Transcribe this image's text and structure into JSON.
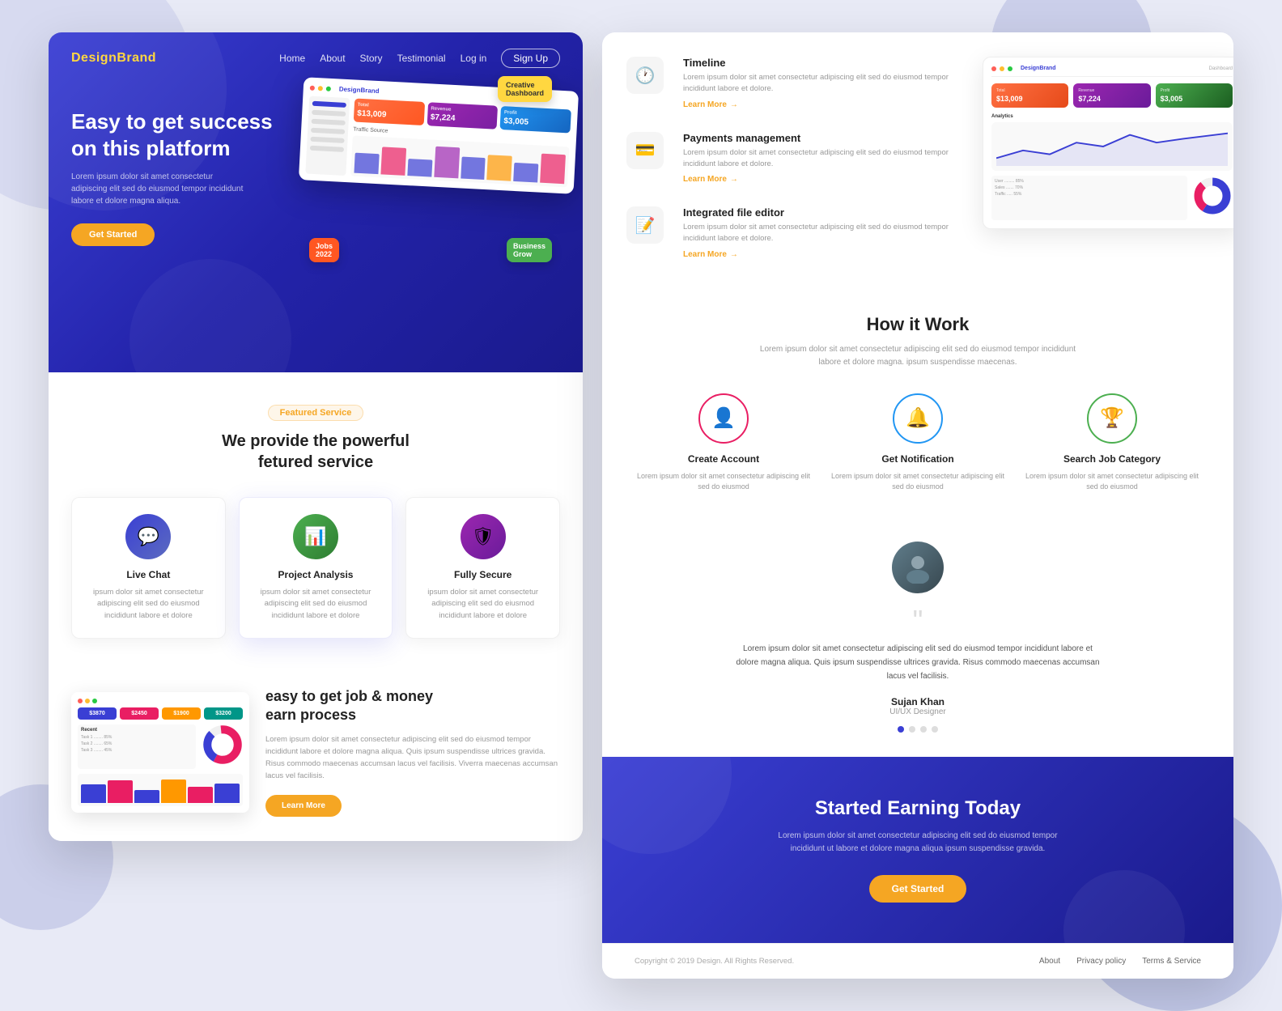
{
  "nav": {
    "logo_prefix": "Design",
    "logo_suffix": "Brand",
    "links": [
      "Home",
      "About",
      "Story",
      "Testimonial"
    ],
    "login": "Log in",
    "signup": "Sign Up"
  },
  "hero": {
    "title_line1": "Easy to get success",
    "title_line2": "on this platform",
    "description": "Lorem ipsum dolor sit amet consectetur adipiscing elit sed do eiusmod tempor incididunt labore et dolore magna aliqua.",
    "cta_button": "Get Started"
  },
  "featured": {
    "tag": "Featured Service",
    "title_line1": "We provide the powerful",
    "title_line2": "fetured service",
    "services": [
      {
        "name": "Live Chat",
        "icon": "💬",
        "description": "ipsum dolor sit amet consectetur adipiscing elit sed do eiusmod incididunt labore et dolore"
      },
      {
        "name": "Project Analysis",
        "icon": "📊",
        "description": "ipsum dolor sit amet consectetur adipiscing elit sed do eiusmod incididunt labore et dolore"
      },
      {
        "name": "Fully Secure",
        "icon": "🛡",
        "description": "ipsum dolor sit amet consectetur adipiscing elit sed do eiusmod incididunt labore et dolore"
      }
    ]
  },
  "earn": {
    "title_line1": "easy to get job & money",
    "title_line2": "earn process",
    "description": "Lorem ipsum dolor sit amet consectetur adipiscing elit sed do eiusmod tempor incididunt labore et dolore magna aliqua. Quis ipsum suspendisse ultrices gravida. Risus commodo maecenas accumsan lacus vel facilisis. Viverra maecenas accumsan lacus vel facilisis.",
    "cta_button": "Learn More"
  },
  "features": [
    {
      "title": "Timeline",
      "icon": "🕐",
      "description": "Lorem ipsum dolor sit amet consectetur adipiscing elit sed do eiusmod tempor incididunt labore et dolore.",
      "learn_more": "Learn More"
    },
    {
      "title": "Payments management",
      "icon": "💳",
      "description": "Lorem ipsum dolor sit amet consectetur adipiscing elit sed do eiusmod tempor incididunt labore et dolore.",
      "learn_more": "Learn More"
    },
    {
      "title": "Integrated file editor",
      "icon": "📝",
      "description": "Lorem ipsum dolor sit amet consectetur adipiscing elit sed do eiusmod tempor incididunt labore et dolore.",
      "learn_more": "Learn More"
    }
  ],
  "how_it_work": {
    "title": "How it Work",
    "description": "Lorem ipsum dolor sit amet consectetur adipiscing elit sed do eiusmod tempor incididunt labore et dolore magna. ipsum suspendisse maecenas.",
    "steps": [
      {
        "name": "Create Account",
        "icon": "👤",
        "description": "Lorem ipsum dolor sit amet consectetur adipiscing elit sed do eiusmod"
      },
      {
        "name": "Get Notification",
        "icon": "🔔",
        "description": "Lorem ipsum dolor sit amet consectetur adipiscing elit sed do eiusmod"
      },
      {
        "name": "Search Job Category",
        "icon": "🏆",
        "description": "Lorem ipsum dolor sit amet consectetur adipiscing elit sed do eiusmod"
      }
    ]
  },
  "testimonial": {
    "quote": "Lorem ipsum dolor sit amet consectetur adipiscing elit sed do eiusmod tempor incididunt labore et dolore magna aliqua. Quis ipsum suspendisse ultrices gravida. Risus commodo maecenas accumsan lacus vel facilisis.",
    "name": "Sujan Khan",
    "role": "UI/UX Designer",
    "dots": 4,
    "active_dot": 0
  },
  "cta": {
    "title": "Started Earning Today",
    "description": "Lorem ipsum dolor sit amet consectetur adipiscing elit sed do eiusmod tempor incididunt ut labore et dolore magna aliqua ipsum suspendisse gravida.",
    "button": "Get Started"
  },
  "footer": {
    "links": [
      "About",
      "Privacy policy",
      "Terms & Service"
    ],
    "copyright": "Copyright © 2019 Design. All Rights Reserved."
  },
  "stats": {
    "left_stats": [
      {
        "label": "Total",
        "value": "$13,009",
        "color": "orange"
      },
      {
        "label": "Revenue",
        "value": "$7,224",
        "color": "purple"
      },
      {
        "label": "Profit",
        "value": "$3,005",
        "color": "blue"
      }
    ]
  }
}
